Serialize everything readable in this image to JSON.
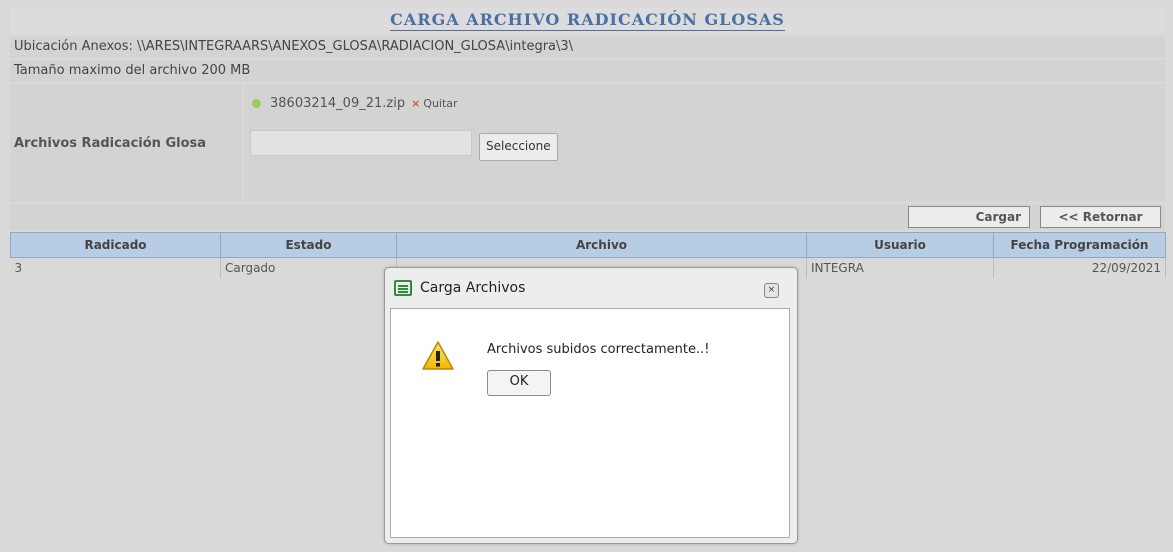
{
  "page": {
    "title": "CARGA ARCHIVO RADICACIÓN GLOSAS",
    "location": "Ubicación Anexos: \\\\ARES\\INTEGRAARS\\ANEXOS_GLOSA\\RADIACION_GLOSA\\integra\\3\\",
    "max_size": "Tamaño maximo del archivo 200 MB"
  },
  "upload": {
    "label": "Archivos Radicación Glosa",
    "uploaded_file": "38603214_09_21.zip",
    "remove_label": "Quitar",
    "remove_icon": "×",
    "file_input_value": "",
    "select_label": "Seleccione"
  },
  "actions": {
    "upload_label": "Cargar",
    "back_label": "<< Retornar"
  },
  "table": {
    "headers": [
      "Radicado",
      "Estado",
      "Archivo",
      "Usuario",
      "Fecha Programación"
    ],
    "rows": [
      [
        "3",
        "Cargado",
        "",
        "INTEGRA",
        "22/09/2021"
      ]
    ]
  },
  "dialog": {
    "title": "Carga Archivos",
    "close_icon": "×",
    "message": "Archivos subidos correctamente..!",
    "ok_label": "OK"
  },
  "colors": {
    "title": "#4a6fa5",
    "header_bg": "#b7cde4",
    "status_dot": "#9acd5a",
    "remove_x": "#e0533a"
  }
}
